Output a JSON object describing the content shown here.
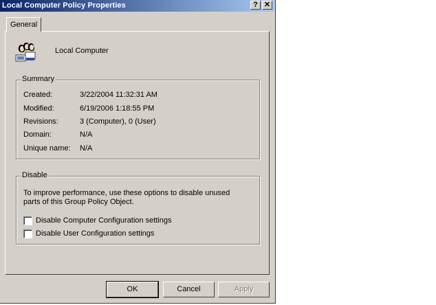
{
  "window": {
    "title": "Local Computer Policy Properties",
    "help_glyph": "?",
    "close_glyph": "✕"
  },
  "tabs": [
    {
      "label": "General"
    }
  ],
  "header": {
    "icon": "users-computer-icon",
    "name": "Local Computer"
  },
  "summary": {
    "label": "Summary",
    "rows": [
      {
        "label": "Created:",
        "value": "3/22/2004 11:32:31 AM"
      },
      {
        "label": "Modified:",
        "value": "6/19/2006 1:18:55 PM"
      },
      {
        "label": "Revisions:",
        "value": "3 (Computer), 0 (User)"
      },
      {
        "label": "Domain:",
        "value": "N/A"
      },
      {
        "label": "Unique name:",
        "value": "N/A"
      }
    ]
  },
  "disable": {
    "label": "Disable",
    "description_line1": "To improve performance, use these options to disable unused",
    "description_line2": "parts of this Group Policy Object.",
    "options": [
      {
        "label": "Disable Computer Configuration settings",
        "checked": false
      },
      {
        "label": "Disable User Configuration settings",
        "checked": false
      }
    ]
  },
  "buttons": {
    "ok": "OK",
    "cancel": "Cancel",
    "apply": "Apply"
  },
  "colors": {
    "face": "#d4d0c8",
    "title_start": "#0a246a",
    "title_end": "#a6caf0"
  }
}
